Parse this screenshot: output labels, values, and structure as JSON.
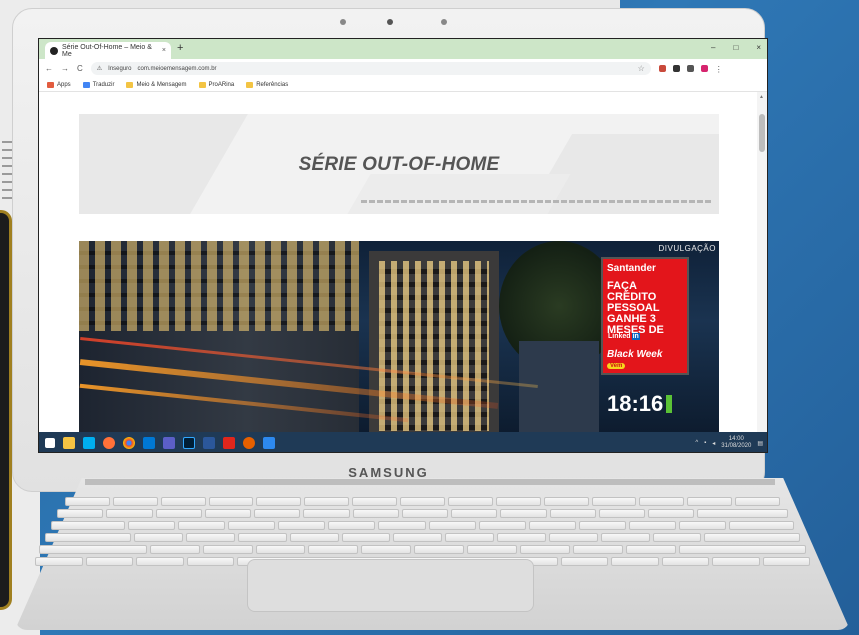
{
  "device": {
    "brand": "SAMSUNG"
  },
  "browser": {
    "tab_title": "Série Out-Of-Home – Meio & Me",
    "tab_close": "×",
    "new_tab": "+",
    "window_controls": {
      "minimize": "–",
      "maximize": "□",
      "close": "×"
    },
    "nav": {
      "back": "←",
      "forward": "→",
      "reload": "C"
    },
    "url_prefix": "Inseguro",
    "url": "com.meioemensagem.com.br",
    "star": "☆",
    "bookmarks": [
      {
        "label": "Apps"
      },
      {
        "label": "Traduzir"
      },
      {
        "label": "Meio & Mensagem"
      },
      {
        "label": "ProARina"
      },
      {
        "label": "Referências"
      }
    ]
  },
  "page": {
    "hero_title": "SÉRIE OUT-OF-HOME",
    "photo_credit": "DIVULGAÇÃO",
    "billboard": {
      "brand": "Santander",
      "headline": "FAÇA CRÉDITO PESSOAL GANHE 3 MESES DE",
      "linkedin": "Linked",
      "linkedin_in": "in",
      "black_week": "Black Week",
      "vem": "Vem",
      "clock": "18:16"
    }
  },
  "taskbar": {
    "time": "14:00",
    "date": "31/08/2020",
    "apps": [
      "start",
      "file-explorer",
      "skype",
      "firefox-orange",
      "chrome",
      "outlook",
      "teams",
      "photoshop",
      "word",
      "acrobat",
      "firefox",
      "photos"
    ]
  },
  "colors": {
    "tabstrip": "#cde6c8",
    "taskbar": "#1f3a56",
    "billboard_red": "#e3151b"
  }
}
